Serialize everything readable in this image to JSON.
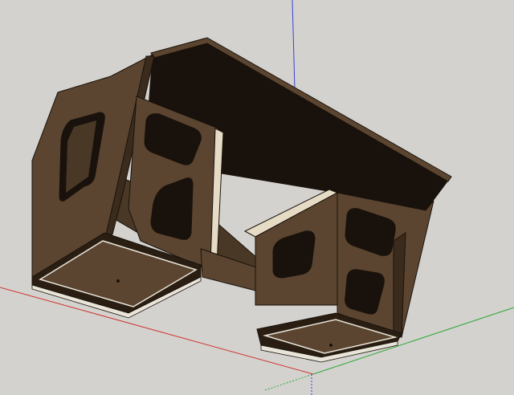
{
  "app": {
    "name": "",
    "view": "3d-modeling-viewport"
  },
  "viewport": {
    "background_color": "#d3d2cf",
    "axes": {
      "x_axis_color": "#d0342c",
      "y_axis_color": "#2fa836",
      "z_axis_color": "#3a40d8"
    },
    "model": {
      "description_icon": "wooden-cabinet-model",
      "wood_color": "#5b4530",
      "wood_dark_color": "#3b2b1c",
      "edge_color": "#1a120b",
      "cavity_color": "#19120c",
      "light_edge_color": "#e8e4d8"
    }
  }
}
